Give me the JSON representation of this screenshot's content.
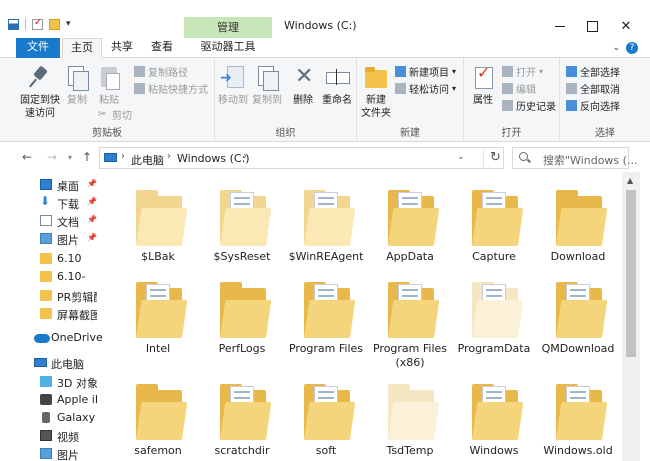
{
  "window": {
    "context_tab": "管理",
    "title": "Windows (C:)"
  },
  "ribbon_tabs": {
    "file": "文件",
    "home": "主页",
    "share": "共享",
    "view": "查看",
    "drive_tools": "驱动器工具"
  },
  "ribbon": {
    "clipboard": {
      "group_label": "剪贴板",
      "pin_label": "固定到快\n速访问",
      "copy_label": "复制",
      "paste_label": "粘贴",
      "copy_path": "复制路径",
      "paste_shortcut": "粘贴快捷方式",
      "cut": "剪切"
    },
    "organize": {
      "group_label": "组织",
      "move_to": "移动到",
      "copy_to": "复制到",
      "delete": "删除",
      "rename": "重命名"
    },
    "new": {
      "group_label": "新建",
      "new_folder": "新建\n文件夹",
      "new_item": "新建项目",
      "easy_access": "轻松访问"
    },
    "open": {
      "group_label": "打开",
      "properties": "属性",
      "open": "打开",
      "edit": "编辑",
      "history": "历史记录"
    },
    "select": {
      "group_label": "选择",
      "select_all": "全部选择",
      "select_none": "全部取消",
      "invert": "反向选择"
    }
  },
  "address": {
    "crumbs": [
      "此电脑",
      "Windows (C:)"
    ],
    "search_placeholder": "搜索\"Windows (..."
  },
  "sidebar": {
    "items": [
      {
        "label": "桌面",
        "icon": "desktop-icon",
        "pinned": true
      },
      {
        "label": "下载",
        "icon": "download-icon",
        "pinned": true
      },
      {
        "label": "文档",
        "icon": "documents-icon",
        "pinned": true
      },
      {
        "label": "图片",
        "icon": "pictures-icon",
        "pinned": true
      },
      {
        "label": "6.10",
        "icon": "folder-icon",
        "pinned": false
      },
      {
        "label": "6.10-",
        "icon": "folder-icon",
        "pinned": false
      },
      {
        "label": "PR剪辑配",
        "icon": "folder-icon",
        "pinned": false
      },
      {
        "label": "屏幕截图",
        "icon": "folder-icon",
        "pinned": false
      }
    ],
    "onedrive": "OneDrive",
    "this_pc": "此电脑",
    "pc_items": [
      {
        "label": "3D 对象",
        "icon": "3d-objects-icon"
      },
      {
        "label": "Apple iPl",
        "icon": "apple-icon"
      },
      {
        "label": "Galaxy O",
        "icon": "phone-icon"
      },
      {
        "label": "视频",
        "icon": "video-icon"
      },
      {
        "label": "图片",
        "icon": "pictures-icon"
      }
    ]
  },
  "files": [
    {
      "name": "$LBak"
    },
    {
      "name": "$SysReset"
    },
    {
      "name": "$WinREAgent"
    },
    {
      "name": "AppData"
    },
    {
      "name": "Capture"
    },
    {
      "name": "Download"
    },
    {
      "name": "Intel"
    },
    {
      "name": "PerfLogs"
    },
    {
      "name": "Program Files"
    },
    {
      "name": "Program Files\n(x86)"
    },
    {
      "name": "ProgramData"
    },
    {
      "name": "QMDownload"
    },
    {
      "name": "safemon"
    },
    {
      "name": "scratchdir"
    },
    {
      "name": "soft"
    },
    {
      "name": "TsdTemp"
    },
    {
      "name": "Windows"
    },
    {
      "name": "Windows.old"
    }
  ]
}
